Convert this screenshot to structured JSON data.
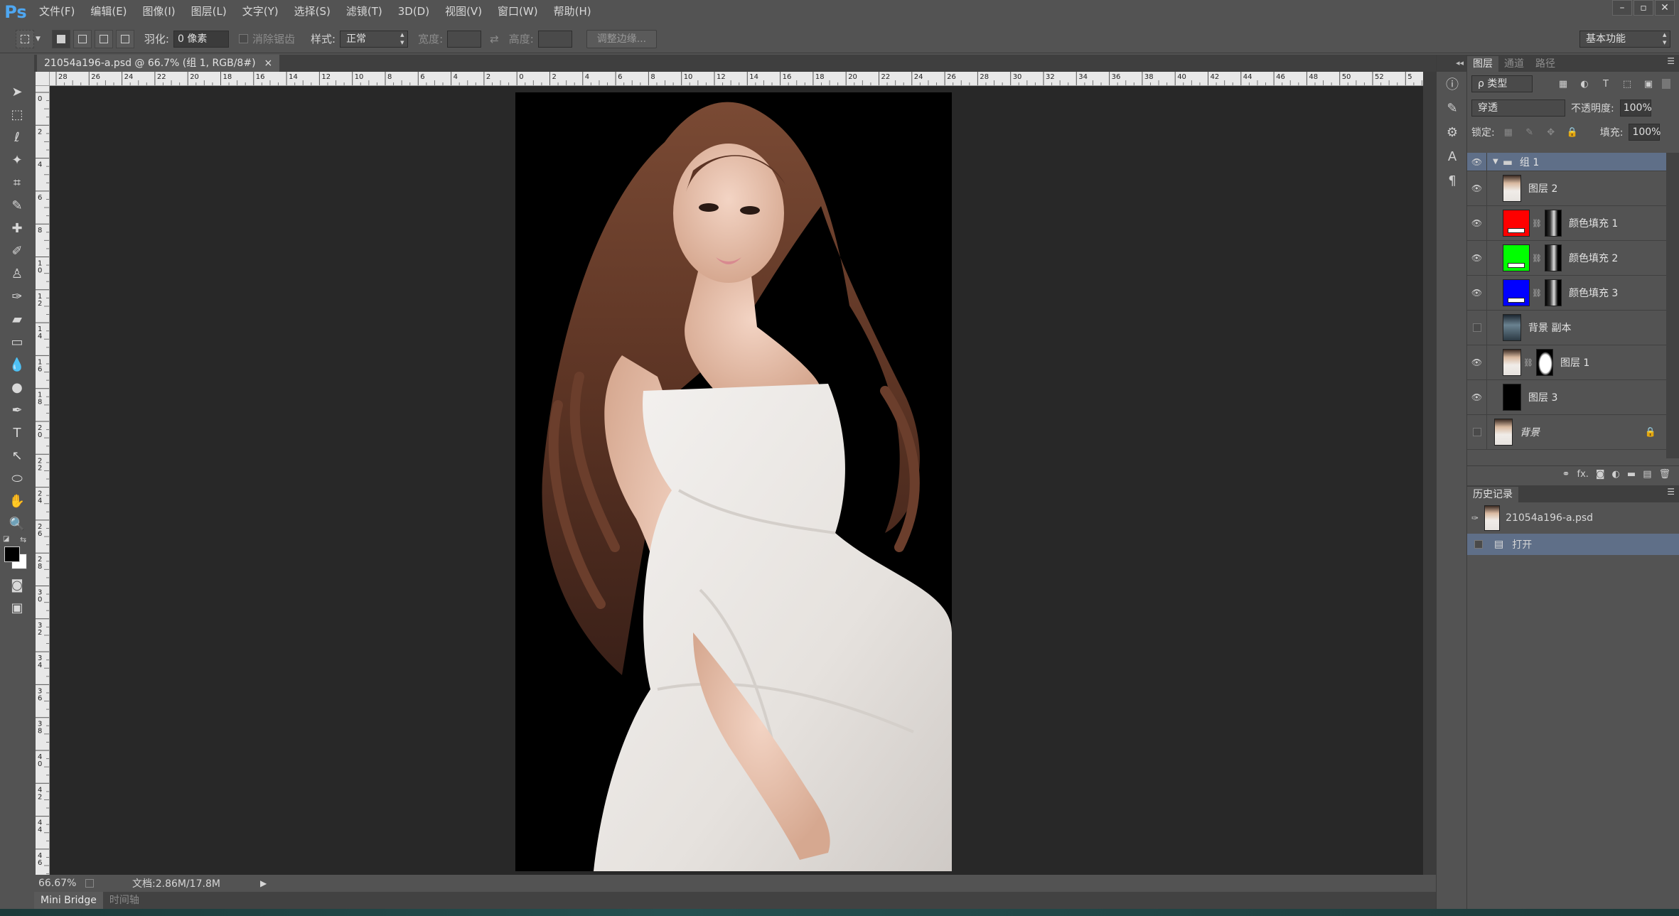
{
  "app": {
    "logo": "Ps"
  },
  "menu": [
    "文件(F)",
    "编辑(E)",
    "图像(I)",
    "图层(L)",
    "文字(Y)",
    "选择(S)",
    "滤镜(T)",
    "3D(D)",
    "视图(V)",
    "窗口(W)",
    "帮助(H)"
  ],
  "window_controls": [
    "–",
    "▫",
    "✕"
  ],
  "options": {
    "feather_label": "羽化:",
    "feather_value": "0 像素",
    "antialias_label": "消除锯齿",
    "style_label": "样式:",
    "style_value": "正常",
    "width_label": "宽度:",
    "height_label": "高度:",
    "refine_button": "调整边缘...",
    "workspace": "基本功能"
  },
  "document": {
    "tab_title": "21054a196-a.psd @ 66.7% (组 1, RGB/8#)",
    "close": "×",
    "zoom": "66.67%",
    "doc_info": "文档:2.86M/17.8M"
  },
  "ruler_top_labels": [
    "28",
    "26",
    "24",
    "22",
    "20",
    "18",
    "16",
    "14",
    "12",
    "10",
    "8",
    "6",
    "4",
    "2",
    "0",
    "2",
    "4",
    "6",
    "8",
    "10",
    "12",
    "14",
    "16",
    "18",
    "20",
    "22",
    "24",
    "26",
    "28",
    "30",
    "32",
    "34",
    "36",
    "38",
    "40",
    "42",
    "44",
    "46",
    "48",
    "50",
    "52",
    "5"
  ],
  "ruler_left_labels": [
    "0",
    "2",
    "4",
    "6",
    "8",
    "1 0",
    "1 2",
    "1 4",
    "1 6",
    "1 8",
    "2 0",
    "2 2",
    "2 4",
    "2 6",
    "2 8",
    "3 0",
    "3 2",
    "3 4",
    "3 6",
    "3 8",
    "4 0",
    "4 2",
    "4 4",
    "4 6"
  ],
  "bottom_tabs": [
    "Mini Bridge",
    "时间轴"
  ],
  "layers_panel": {
    "tabs": [
      "图层",
      "通道",
      "路径"
    ],
    "filter_kind": "ρ 类型",
    "blend_mode": "穿透",
    "opacity_label": "不透明度:",
    "opacity_value": "100%",
    "lock_label": "锁定:",
    "fill_label": "填充:",
    "fill_value": "100%",
    "layers": [
      {
        "name": "组 1",
        "visible": true,
        "type": "group"
      },
      {
        "name": "图层 2",
        "visible": true,
        "type": "photo"
      },
      {
        "name": "颜色填充 1",
        "visible": true,
        "type": "fill",
        "color": "#ff0000"
      },
      {
        "name": "颜色填充 2",
        "visible": true,
        "type": "fill",
        "color": "#00ff00"
      },
      {
        "name": "颜色填充 3",
        "visible": true,
        "type": "fill",
        "color": "#0000ff"
      },
      {
        "name": "背景 副本",
        "visible": false,
        "type": "photo-dark"
      },
      {
        "name": "图层 1",
        "visible": true,
        "type": "photo-mask"
      },
      {
        "name": "图层 3",
        "visible": true,
        "type": "black"
      },
      {
        "name": "背景",
        "visible": false,
        "type": "background"
      }
    ],
    "footer_icons": [
      "link-icon",
      "fx-icon",
      "mask-icon",
      "adjustment-icon",
      "folder-icon",
      "new-layer-icon",
      "trash-icon"
    ]
  },
  "history_panel": {
    "tab": "历史记录",
    "snapshot": "21054a196-a.psd",
    "steps": [
      "打开"
    ]
  },
  "colors": {
    "selected_row": "#5f6f88",
    "ps_blue": "#4ea7f2"
  }
}
